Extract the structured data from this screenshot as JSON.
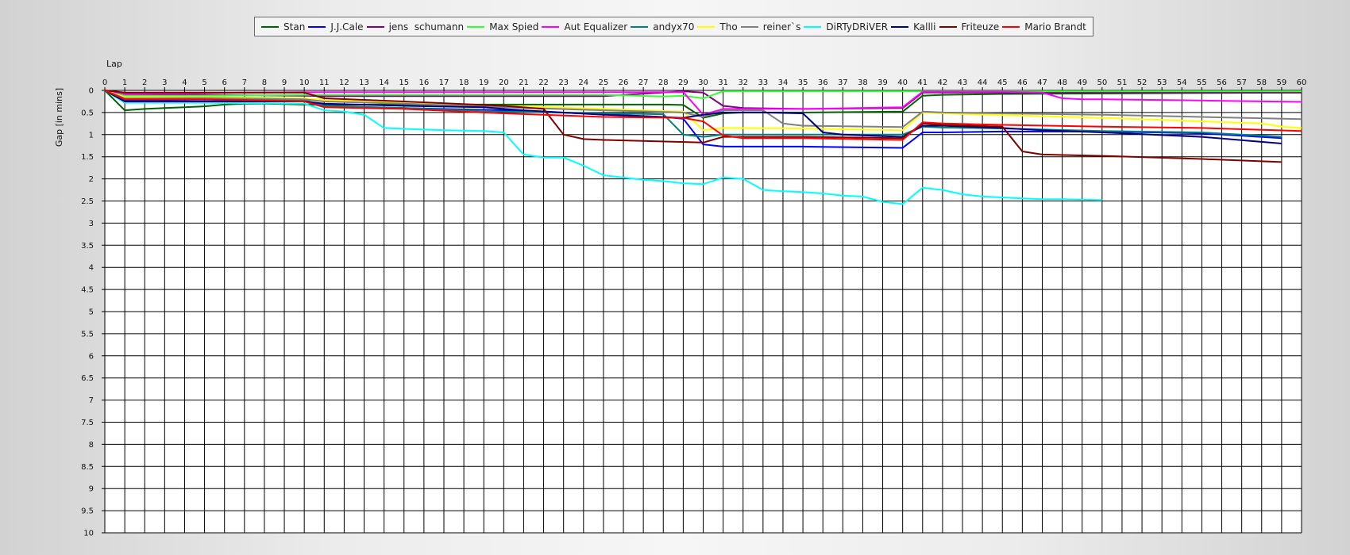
{
  "chart_data": {
    "type": "line",
    "xlabel": "Lap",
    "ylabel": "Gap [in mins]",
    "xlim": [
      0,
      60
    ],
    "ylim": [
      0,
      10
    ],
    "x_tick_step": 1,
    "y_tick_step": 0.5,
    "y_inverted": true,
    "grid": true,
    "legend_position": "top",
    "series": [
      {
        "name": "Stan",
        "color": "#006400",
        "points": [
          [
            0,
            0
          ],
          [
            1,
            0.45
          ],
          [
            2,
            0.42
          ],
          [
            3,
            0.4
          ],
          [
            4,
            0.38
          ],
          [
            5,
            0.36
          ],
          [
            6,
            0.32
          ],
          [
            7,
            0.3
          ],
          [
            8,
            0.3
          ],
          [
            9,
            0.31
          ],
          [
            10,
            0.32
          ],
          [
            11,
            0.33
          ],
          [
            15,
            0.32
          ],
          [
            20,
            0.32
          ],
          [
            25,
            0.32
          ],
          [
            28,
            0.32
          ],
          [
            29,
            0.33
          ],
          [
            30,
            0.62
          ],
          [
            31,
            0.52
          ],
          [
            32,
            0.5
          ],
          [
            33,
            0.5
          ],
          [
            35,
            0.5
          ],
          [
            40,
            0.48
          ],
          [
            41,
            0.12
          ],
          [
            42,
            0.1
          ],
          [
            45,
            0.08
          ],
          [
            50,
            0.07
          ],
          [
            55,
            0.06
          ],
          [
            60,
            0.05
          ]
        ]
      },
      {
        "name": "J.J.Cale",
        "color": "#0000ff",
        "points": [
          [
            0,
            0
          ],
          [
            1,
            0.22
          ],
          [
            2,
            0.22
          ],
          [
            5,
            0.21
          ],
          [
            10,
            0.24
          ],
          [
            11,
            0.35
          ],
          [
            12,
            0.37
          ],
          [
            15,
            0.4
          ],
          [
            20,
            0.45
          ],
          [
            25,
            0.54
          ],
          [
            28,
            0.6
          ],
          [
            29,
            0.64
          ],
          [
            30,
            1.22
          ],
          [
            31,
            1.27
          ],
          [
            35,
            1.27
          ],
          [
            40,
            1.3
          ],
          [
            41,
            0.95
          ],
          [
            42,
            0.95
          ],
          [
            45,
            0.93
          ],
          [
            50,
            0.93
          ],
          [
            55,
            0.97
          ],
          [
            59,
            1.08
          ]
        ]
      },
      {
        "name": "jens  schumann",
        "color": "#800080",
        "points": [
          [
            0,
            0
          ],
          [
            1,
            0.1
          ],
          [
            2,
            0.1
          ],
          [
            5,
            0.1
          ],
          [
            10,
            0.12
          ],
          [
            11,
            0.13
          ],
          [
            15,
            0.13
          ],
          [
            20,
            0.13
          ],
          [
            25,
            0.13
          ],
          [
            29,
            0.02
          ],
          [
            30,
            0.05
          ],
          [
            31,
            0.35
          ],
          [
            32,
            0.4
          ],
          [
            35,
            0.42
          ],
          [
            40,
            0.4
          ],
          [
            41,
            0.05
          ],
          [
            42,
            0.05
          ],
          [
            45,
            0.05
          ],
          [
            50,
            0.05
          ],
          [
            55,
            0.05
          ],
          [
            60,
            0.05
          ]
        ]
      },
      {
        "name": "Max Spied",
        "color": "#33ff33",
        "points": [
          [
            0,
            0
          ],
          [
            1,
            0.12
          ],
          [
            2,
            0.12
          ],
          [
            5,
            0.12
          ],
          [
            10,
            0.1
          ],
          [
            15,
            0.1
          ],
          [
            20,
            0.1
          ],
          [
            25,
            0.1
          ],
          [
            28,
            0.14
          ],
          [
            29,
            0.12
          ],
          [
            30,
            0.18
          ],
          [
            31,
            0.02
          ],
          [
            35,
            0.02
          ],
          [
            40,
            0.02
          ],
          [
            41,
            0.02
          ],
          [
            45,
            0.02
          ],
          [
            50,
            0.02
          ],
          [
            55,
            0.02
          ],
          [
            60,
            0.02
          ]
        ]
      },
      {
        "name": "Aut Equalizer",
        "color": "#ff00ff",
        "points": [
          [
            0,
            0
          ],
          [
            1,
            0.08
          ],
          [
            5,
            0.06
          ],
          [
            10,
            0.04
          ],
          [
            15,
            0.04
          ],
          [
            20,
            0.04
          ],
          [
            25,
            0.04
          ],
          [
            29,
            0.04
          ],
          [
            30,
            0.55
          ],
          [
            31,
            0.42
          ],
          [
            35,
            0.42
          ],
          [
            40,
            0.38
          ],
          [
            41,
            0.03
          ],
          [
            45,
            0.03
          ],
          [
            47,
            0.05
          ],
          [
            48,
            0.18
          ],
          [
            49,
            0.2
          ],
          [
            50,
            0.2
          ],
          [
            55,
            0.23
          ],
          [
            60,
            0.26
          ]
        ]
      },
      {
        "name": "andyx70",
        "color": "#008080",
        "points": [
          [
            0,
            0
          ],
          [
            1,
            0.2
          ],
          [
            5,
            0.2
          ],
          [
            10,
            0.22
          ],
          [
            11,
            0.35
          ],
          [
            15,
            0.4
          ],
          [
            20,
            0.48
          ],
          [
            25,
            0.52
          ],
          [
            28,
            0.54
          ],
          [
            29,
            1.0
          ],
          [
            30,
            1.05
          ],
          [
            31,
            1.0
          ],
          [
            35,
            1.0
          ],
          [
            40,
            1.0
          ],
          [
            41,
            0.82
          ],
          [
            42,
            0.84
          ],
          [
            45,
            0.86
          ],
          [
            50,
            0.92
          ],
          [
            55,
            0.95
          ],
          [
            59,
            1.05
          ]
        ]
      },
      {
        "name": "Tho",
        "color": "#ffff00",
        "points": [
          [
            0,
            0
          ],
          [
            1,
            0.15
          ],
          [
            5,
            0.15
          ],
          [
            10,
            0.18
          ],
          [
            11,
            0.22
          ],
          [
            15,
            0.28
          ],
          [
            20,
            0.35
          ],
          [
            25,
            0.42
          ],
          [
            29,
            0.48
          ],
          [
            30,
            0.9
          ],
          [
            31,
            0.85
          ],
          [
            35,
            0.86
          ],
          [
            40,
            0.9
          ],
          [
            41,
            0.5
          ],
          [
            42,
            0.52
          ],
          [
            45,
            0.56
          ],
          [
            50,
            0.62
          ],
          [
            55,
            0.7
          ],
          [
            58,
            0.75
          ],
          [
            59,
            0.82
          ],
          [
            60,
            0.85
          ]
        ]
      },
      {
        "name": "reiner`s",
        "color": "#808080",
        "points": [
          [
            0,
            0
          ],
          [
            1,
            0.18
          ],
          [
            5,
            0.17
          ],
          [
            10,
            0.2
          ],
          [
            11,
            0.25
          ],
          [
            15,
            0.3
          ],
          [
            20,
            0.38
          ],
          [
            25,
            0.45
          ],
          [
            29,
            0.5
          ],
          [
            30,
            0.6
          ],
          [
            31,
            0.45
          ],
          [
            33,
            0.45
          ],
          [
            34,
            0.75
          ],
          [
            35,
            0.8
          ],
          [
            40,
            0.83
          ],
          [
            41,
            0.48
          ],
          [
            42,
            0.5
          ],
          [
            45,
            0.52
          ],
          [
            50,
            0.55
          ],
          [
            55,
            0.6
          ],
          [
            60,
            0.65
          ]
        ]
      },
      {
        "name": "DiRTyDRiVER",
        "color": "#00ffff",
        "points": [
          [
            0,
            0
          ],
          [
            1,
            0.28
          ],
          [
            5,
            0.28
          ],
          [
            10,
            0.3
          ],
          [
            11,
            0.45
          ],
          [
            12,
            0.48
          ],
          [
            13,
            0.55
          ],
          [
            14,
            0.85
          ],
          [
            15,
            0.87
          ],
          [
            17,
            0.9
          ],
          [
            19,
            0.92
          ],
          [
            20,
            0.95
          ],
          [
            21,
            1.45
          ],
          [
            22,
            1.52
          ],
          [
            23,
            1.52
          ],
          [
            24,
            1.7
          ],
          [
            25,
            1.92
          ],
          [
            27,
            2.02
          ],
          [
            28,
            2.05
          ],
          [
            29,
            2.1
          ],
          [
            30,
            2.12
          ],
          [
            31,
            1.97
          ],
          [
            32,
            2.0
          ],
          [
            33,
            2.25
          ],
          [
            34,
            2.28
          ],
          [
            35,
            2.3
          ],
          [
            36,
            2.33
          ],
          [
            37,
            2.38
          ],
          [
            38,
            2.4
          ],
          [
            39,
            2.52
          ],
          [
            40,
            2.57
          ],
          [
            41,
            2.2
          ],
          [
            42,
            2.25
          ],
          [
            43,
            2.35
          ],
          [
            44,
            2.4
          ],
          [
            45,
            2.42
          ],
          [
            46,
            2.44
          ],
          [
            47,
            2.46
          ],
          [
            48,
            2.46
          ],
          [
            49,
            2.47
          ],
          [
            50,
            2.48
          ]
        ]
      },
      {
        "name": "Kallli",
        "color": "#000080",
        "points": [
          [
            0,
            0
          ],
          [
            1,
            0.25
          ],
          [
            5,
            0.25
          ],
          [
            10,
            0.25
          ],
          [
            11,
            0.3
          ],
          [
            15,
            0.35
          ],
          [
            19,
            0.38
          ],
          [
            20,
            0.42
          ],
          [
            21,
            0.45
          ],
          [
            25,
            0.55
          ],
          [
            29,
            0.62
          ],
          [
            30,
            0.55
          ],
          [
            31,
            0.5
          ],
          [
            33,
            0.5
          ],
          [
            35,
            0.52
          ],
          [
            36,
            0.95
          ],
          [
            37,
            1.0
          ],
          [
            40,
            1.05
          ],
          [
            41,
            0.8
          ],
          [
            42,
            0.8
          ],
          [
            45,
            0.85
          ],
          [
            47,
            0.9
          ],
          [
            50,
            0.95
          ],
          [
            55,
            1.05
          ],
          [
            59,
            1.2
          ]
        ]
      },
      {
        "name": "Friteuze",
        "color": "#800000",
        "points": [
          [
            0,
            0
          ],
          [
            1,
            0.05
          ],
          [
            5,
            0.05
          ],
          [
            10,
            0.05
          ],
          [
            11,
            0.18
          ],
          [
            15,
            0.25
          ],
          [
            20,
            0.35
          ],
          [
            22,
            0.42
          ],
          [
            23,
            1.0
          ],
          [
            24,
            1.1
          ],
          [
            25,
            1.12
          ],
          [
            30,
            1.18
          ],
          [
            31,
            1.05
          ],
          [
            35,
            1.05
          ],
          [
            40,
            1.08
          ],
          [
            41,
            0.75
          ],
          [
            42,
            0.78
          ],
          [
            45,
            0.82
          ],
          [
            46,
            1.38
          ],
          [
            47,
            1.45
          ],
          [
            50,
            1.48
          ],
          [
            55,
            1.55
          ],
          [
            59,
            1.62
          ]
        ]
      },
      {
        "name": "Mario Brandt",
        "color": "#ff0000",
        "points": [
          [
            0,
            0
          ],
          [
            1,
            0.2
          ],
          [
            5,
            0.2
          ],
          [
            10,
            0.25
          ],
          [
            11,
            0.38
          ],
          [
            15,
            0.42
          ],
          [
            20,
            0.52
          ],
          [
            25,
            0.6
          ],
          [
            29,
            0.62
          ],
          [
            30,
            0.7
          ],
          [
            31,
            1.02
          ],
          [
            32,
            1.08
          ],
          [
            35,
            1.08
          ],
          [
            40,
            1.12
          ],
          [
            41,
            0.72
          ],
          [
            42,
            0.75
          ],
          [
            45,
            0.78
          ],
          [
            50,
            0.82
          ],
          [
            55,
            0.85
          ],
          [
            60,
            0.92
          ]
        ]
      }
    ]
  }
}
